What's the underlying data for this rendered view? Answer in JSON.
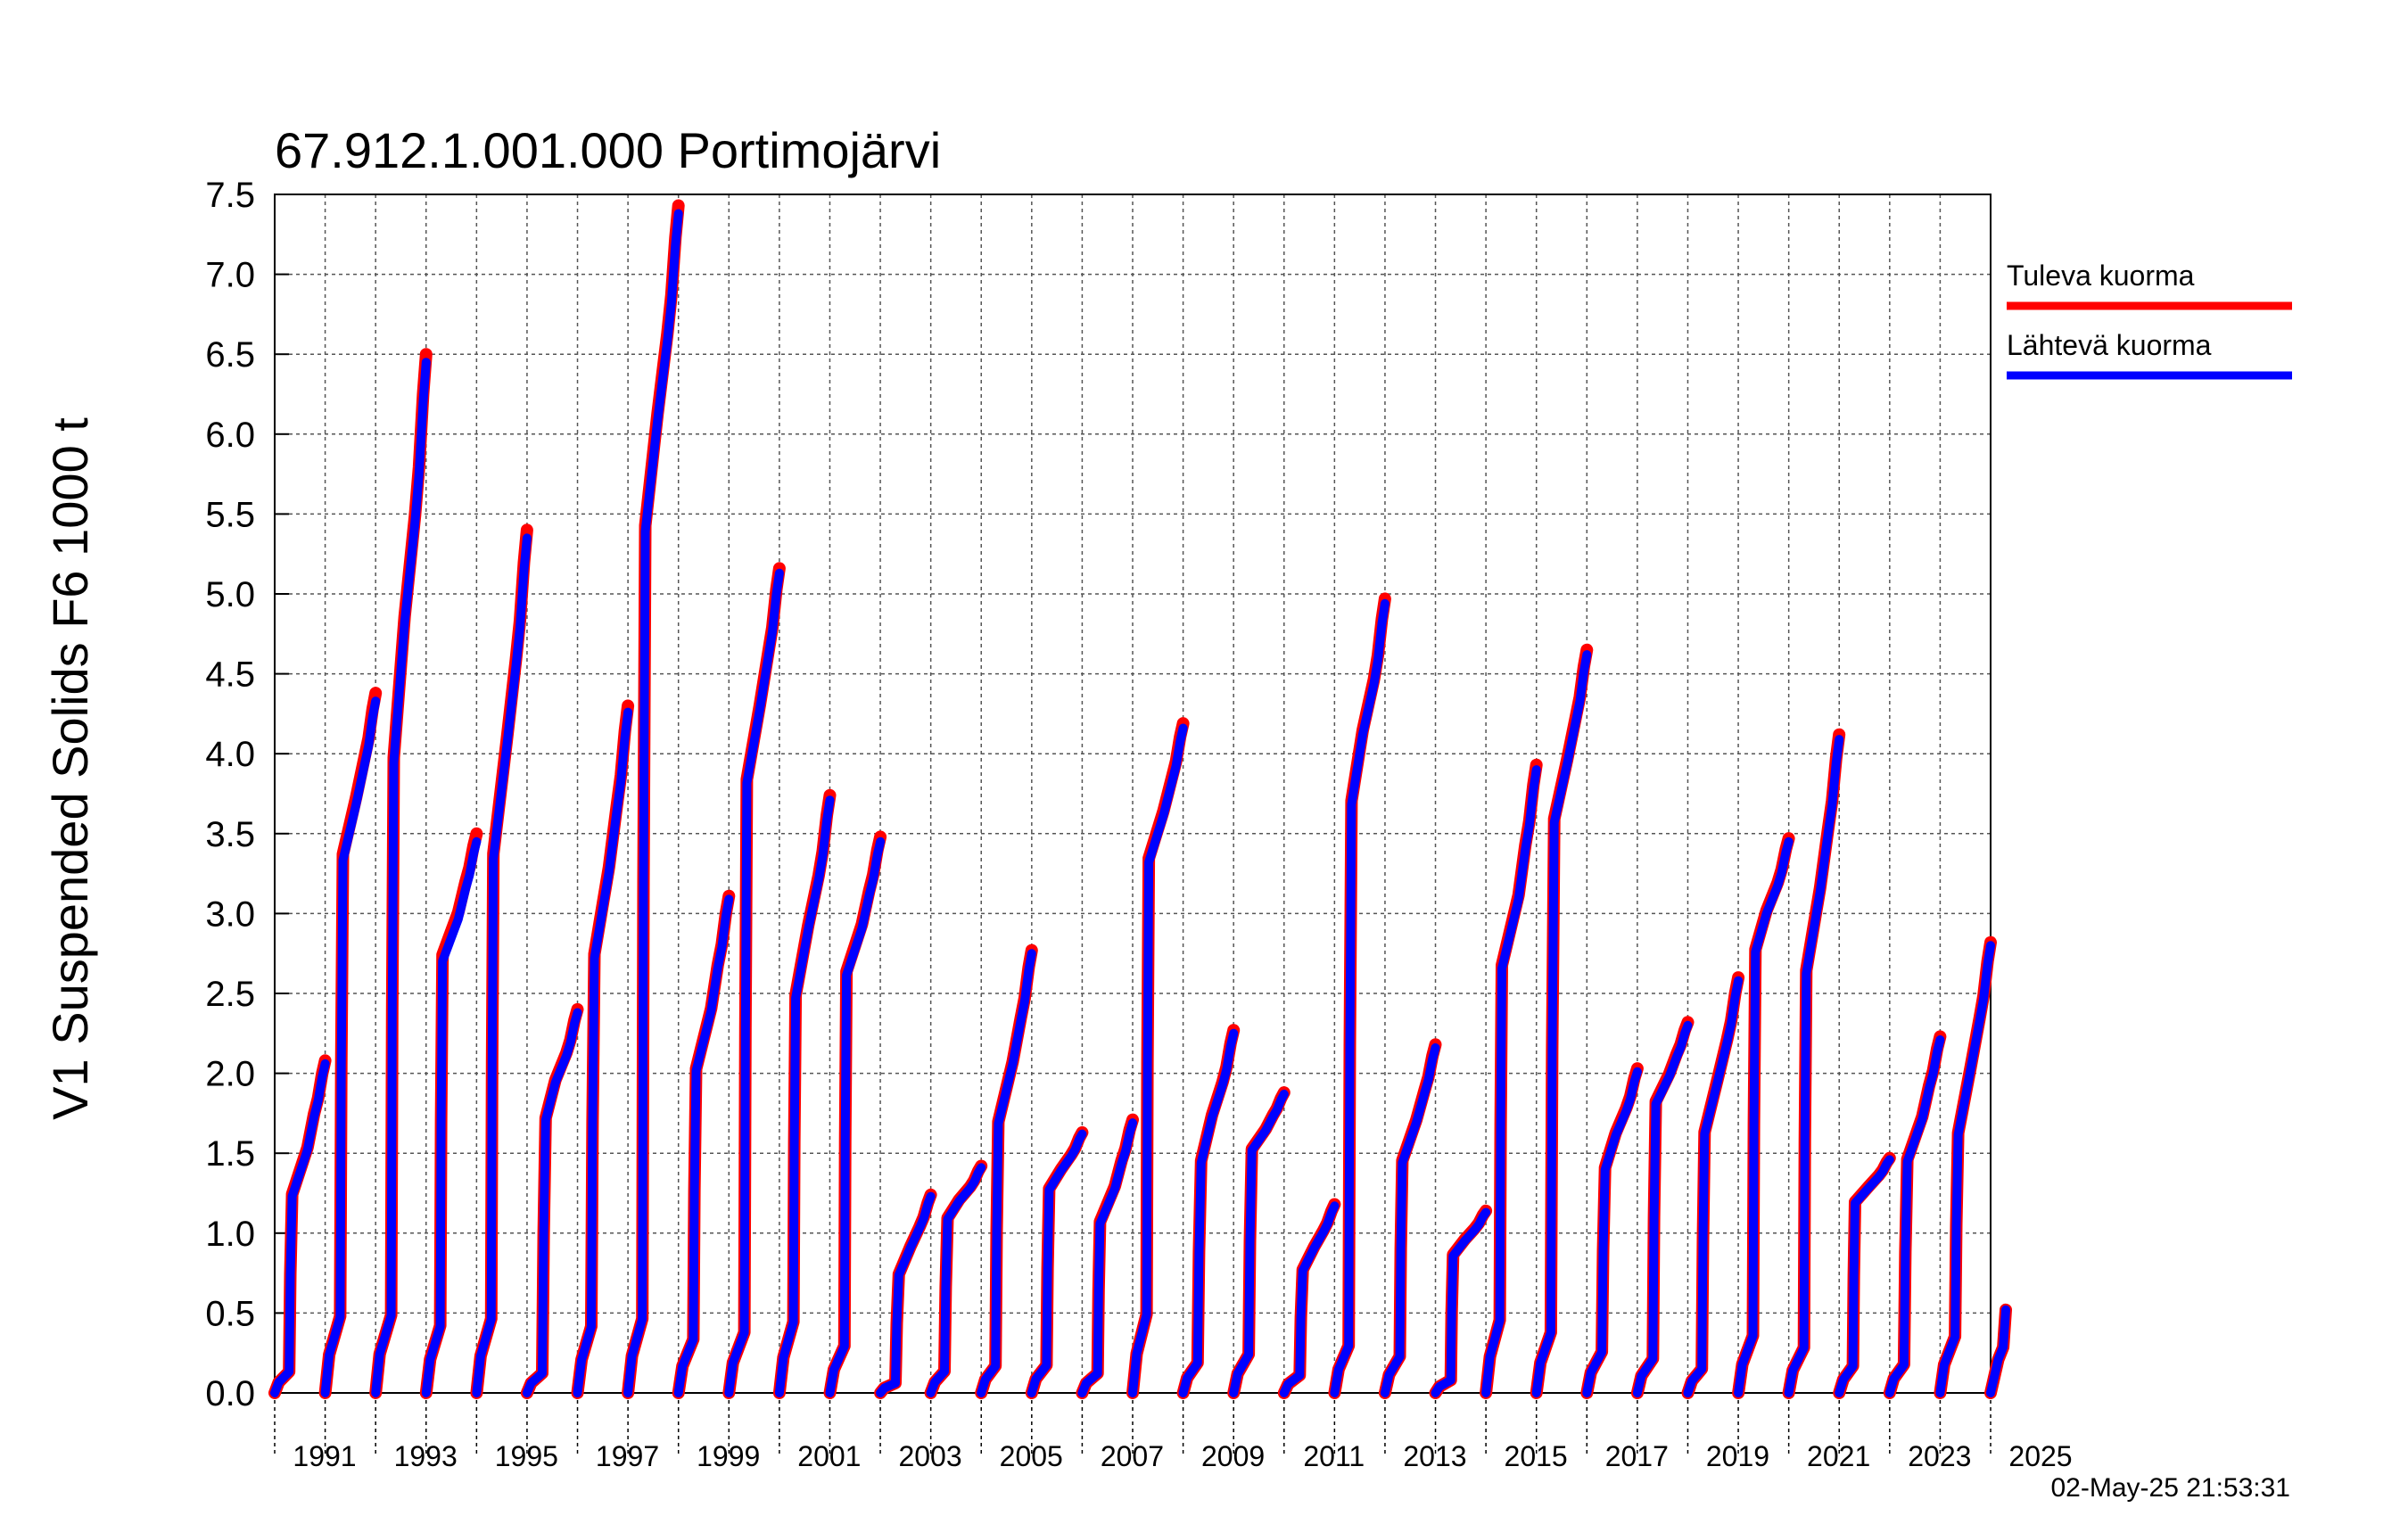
{
  "chart_data": {
    "type": "line",
    "title": "67.912.1.001.000 Portimojärvi",
    "ylabel": "V1 Suspended Solids F6 1000 t",
    "xlabel": "",
    "xlim": [
      1991.0,
      2025.0
    ],
    "ylim": [
      0.0,
      7.5
    ],
    "yticks": [
      "0.0",
      "0.5",
      "1.0",
      "1.5",
      "2.0",
      "2.5",
      "3.0",
      "3.5",
      "4.0",
      "4.5",
      "5.0",
      "5.5",
      "6.0",
      "6.5",
      "7.0",
      "7.5"
    ],
    "xtick_labels": [
      "1991",
      "1993",
      "1995",
      "1997",
      "1999",
      "2001",
      "2003",
      "2005",
      "2007",
      "2009",
      "2011",
      "2013",
      "2015",
      "2017",
      "2019",
      "2021",
      "2023",
      "2025"
    ],
    "grid": true,
    "legend_position": "right",
    "timestamp": "02-May-25 21:53:31",
    "series": [
      {
        "name": "Tuleva kuorma",
        "color": "#ff0000",
        "annual_totals": [
          {
            "year": 1991,
            "total": 2.08
          },
          {
            "year": 1992,
            "total": 4.38
          },
          {
            "year": 1993,
            "total": 6.5
          },
          {
            "year": 1994,
            "total": 3.5
          },
          {
            "year": 1995,
            "total": 5.4
          },
          {
            "year": 1996,
            "total": 2.4
          },
          {
            "year": 1997,
            "total": 4.3
          },
          {
            "year": 1998,
            "total": 7.43
          },
          {
            "year": 1999,
            "total": 3.11
          },
          {
            "year": 2000,
            "total": 5.16
          },
          {
            "year": 2001,
            "total": 3.74
          },
          {
            "year": 2002,
            "total": 3.48
          },
          {
            "year": 2003,
            "total": 1.24
          },
          {
            "year": 2004,
            "total": 1.42
          },
          {
            "year": 2005,
            "total": 2.77
          },
          {
            "year": 2006,
            "total": 1.63
          },
          {
            "year": 2007,
            "total": 1.71
          },
          {
            "year": 2008,
            "total": 4.19
          },
          {
            "year": 2009,
            "total": 2.27
          },
          {
            "year": 2010,
            "total": 1.88
          },
          {
            "year": 2011,
            "total": 1.18
          },
          {
            "year": 2012,
            "total": 4.97
          },
          {
            "year": 2013,
            "total": 2.18
          },
          {
            "year": 2014,
            "total": 1.14
          },
          {
            "year": 2015,
            "total": 3.93
          },
          {
            "year": 2016,
            "total": 4.65
          },
          {
            "year": 2017,
            "total": 2.03
          },
          {
            "year": 2018,
            "total": 2.32
          },
          {
            "year": 2019,
            "total": 2.6
          },
          {
            "year": 2020,
            "total": 3.47
          },
          {
            "year": 2021,
            "total": 4.12
          },
          {
            "year": 2022,
            "total": 1.47
          },
          {
            "year": 2023,
            "total": 2.23
          },
          {
            "year": 2024,
            "total": 2.82
          },
          {
            "year": 2025,
            "total": 0.52
          }
        ]
      },
      {
        "name": "Lähtevä kuorma",
        "color": "#0000ff",
        "annual_totals": [
          {
            "year": 1991,
            "total": 2.06
          },
          {
            "year": 1992,
            "total": 4.33
          },
          {
            "year": 1993,
            "total": 6.45
          },
          {
            "year": 1994,
            "total": 3.45
          },
          {
            "year": 1995,
            "total": 5.35
          },
          {
            "year": 1996,
            "total": 2.38
          },
          {
            "year": 1997,
            "total": 4.26
          },
          {
            "year": 1998,
            "total": 7.38
          },
          {
            "year": 1999,
            "total": 3.09
          },
          {
            "year": 2000,
            "total": 5.13
          },
          {
            "year": 2001,
            "total": 3.71
          },
          {
            "year": 2002,
            "total": 3.45
          },
          {
            "year": 2003,
            "total": 1.23
          },
          {
            "year": 2004,
            "total": 1.41
          },
          {
            "year": 2005,
            "total": 2.75
          },
          {
            "year": 2006,
            "total": 1.62
          },
          {
            "year": 2007,
            "total": 1.69
          },
          {
            "year": 2008,
            "total": 4.16
          },
          {
            "year": 2009,
            "total": 2.25
          },
          {
            "year": 2010,
            "total": 1.87
          },
          {
            "year": 2011,
            "total": 1.17
          },
          {
            "year": 2012,
            "total": 4.94
          },
          {
            "year": 2013,
            "total": 2.16
          },
          {
            "year": 2014,
            "total": 1.13
          },
          {
            "year": 2015,
            "total": 3.9
          },
          {
            "year": 2016,
            "total": 4.62
          },
          {
            "year": 2017,
            "total": 2.01
          },
          {
            "year": 2018,
            "total": 2.3
          },
          {
            "year": 2019,
            "total": 2.58
          },
          {
            "year": 2020,
            "total": 3.45
          },
          {
            "year": 2021,
            "total": 4.09
          },
          {
            "year": 2022,
            "total": 1.46
          },
          {
            "year": 2023,
            "total": 2.21
          },
          {
            "year": 2024,
            "total": 2.8
          },
          {
            "year": 2025,
            "total": 0.52
          }
        ]
      }
    ]
  }
}
